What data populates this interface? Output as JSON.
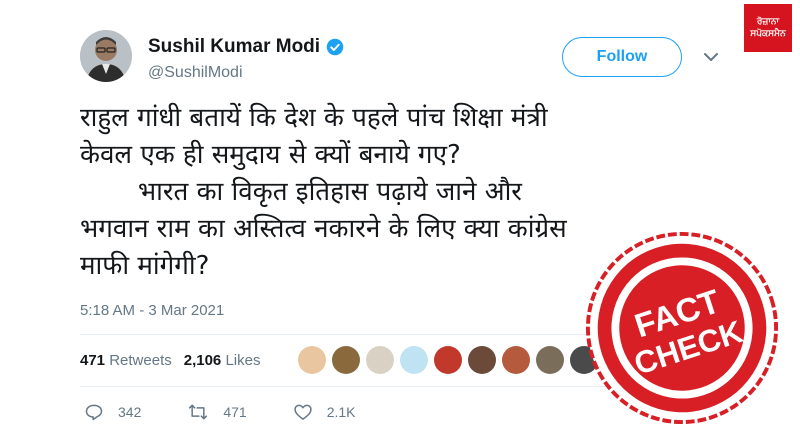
{
  "tweet": {
    "display_name": "Sushil Kumar Modi",
    "handle": "@SushilModi",
    "follow_label": "Follow",
    "text": "राहुल गांधी बतायें कि देश के पहले पांच शिक्षा मंत्री\nकेवल एक ही समुदाय से क्यों बनाये गए?\n       भारत का विकृत इतिहास पढ़ाये जाने और\nभगवान राम का अस्तित्व नकारने के लिए क्या कांग्रेस\nमाफी मांगेगी?",
    "timestamp": "5:18 AM - 3 Mar 2021",
    "retweets_count": "471",
    "retweets_label": "Retweets",
    "likes_count": "2,106",
    "likes_label": "Likes",
    "replies": "342",
    "retweets": "471",
    "likes": "2.1K"
  },
  "overlay": {
    "logo_line1": "ਰੋਜ਼ਾਨਾ",
    "logo_line2": "ਸਪੋਕਸਮੈਨ",
    "stamp_line1": "FACT",
    "stamp_line2": "CHECK"
  },
  "colors": {
    "accent": "#1da1f2",
    "muted": "#657786",
    "stamp_red": "#d81f26"
  },
  "icons": [
    "verified-badge-icon",
    "chevron-down-icon",
    "reply-icon",
    "retweet-icon",
    "like-icon"
  ]
}
